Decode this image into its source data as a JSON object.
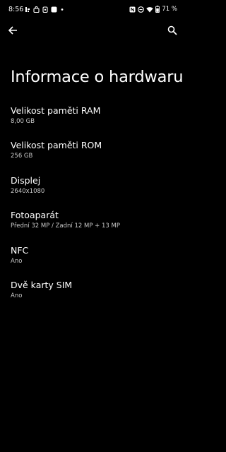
{
  "status_bar": {
    "time": "8:56",
    "battery_percent": "71 %"
  },
  "toolbar": {
    "back_icon": "arrow-back-icon",
    "search_icon": "search-icon"
  },
  "page": {
    "title": "Informace o hardwaru"
  },
  "items": [
    {
      "title": "Velikost paměti RAM",
      "value": "8,00 GB"
    },
    {
      "title": "Velikost paměti ROM",
      "value": "256 GB"
    },
    {
      "title": "Displej",
      "value": "2640x1080"
    },
    {
      "title": "Fotoaparát",
      "value": "Přední 32 MP / Zadní 12 MP + 13 MP"
    },
    {
      "title": "NFC",
      "value": "Ano"
    },
    {
      "title": "Dvě karty SIM",
      "value": "Ano"
    }
  ]
}
